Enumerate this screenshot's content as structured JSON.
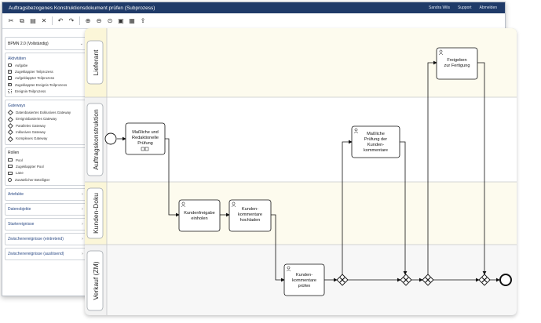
{
  "window": {
    "title": "Auftragsbezogenes Konstruktionsdokument prüfen (Subprozess)",
    "links": [
      "Sandra Wils",
      "Support",
      "Abmelden"
    ]
  },
  "toolbar": {
    "icons": [
      "cut-icon",
      "copy-icon",
      "paste-icon",
      "delete-icon",
      "undo-icon",
      "redo-icon",
      "zoom-in-icon",
      "zoom-out-icon",
      "zoom-fit-icon",
      "image-export-icon",
      "save-icon",
      "share-icon"
    ]
  },
  "sidebar": {
    "notation": "BPMN 2.0 (Vollständig)",
    "activities": {
      "title": "Aktivitäten",
      "items": [
        "Aufgabe",
        "Zugeklappter Teilprozess",
        "Aufgeklappter Teilprozess",
        "Zugeklappter Ereignis-Teilprozess",
        "Ereignis-Teilprozess"
      ]
    },
    "gateways": {
      "title": "Gateways",
      "items": [
        "Datenbasiertes Exklusives Gateway",
        "Ereignisbasiertes Gateway",
        "Paralleles Gateway",
        "Inklusives Gateway",
        "Komplexes Gateway"
      ]
    },
    "roles": {
      "title": "Rollen",
      "items": [
        "Pool",
        "Zugeklappter Pool",
        "Lane",
        "Zusätzlicher Beteiligter"
      ]
    },
    "collapsed": [
      "Artefakte",
      "Datenobjekte",
      "Startereignisse",
      "Zwischenereignisse (eintretend)",
      "Zwischenereignisse (auslösend)"
    ]
  },
  "diagram": {
    "lanes": [
      "Lieferant",
      "Auftragskonstruktion",
      "Kunden-Doku",
      "Verkauf (ZM)"
    ],
    "tasks": {
      "task1": [
        "Maßliche und",
        "Redaktionelle",
        "Prüfung"
      ],
      "task2": [
        "Kundenfreigabe",
        "einholen"
      ],
      "task3": [
        "Kunden-",
        "kommentare",
        "hochladen"
      ],
      "task4": [
        "Kunden-",
        "kommentare",
        "prüfen"
      ],
      "task5": [
        "Maßliche",
        "Prüfung der",
        "Kunden-",
        "kommentare"
      ],
      "task6": [
        "Freigeben",
        "zur Fertigung"
      ]
    }
  },
  "colors": {
    "titlebar": "#1f3a68",
    "accent": "#2b4a85",
    "lane_header": "#fbf6d8",
    "lane_header_alt": "#f2f2f2",
    "lane_light": "#fdfbee",
    "lane_gray": "#f7f7f7"
  }
}
